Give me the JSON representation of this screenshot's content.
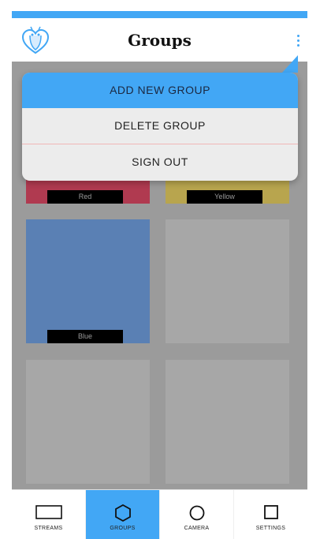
{
  "app": {
    "title": "Groups"
  },
  "icons": {
    "logo": "heart-bug-logo-icon",
    "menu": "overflow-menu-icon"
  },
  "colors": {
    "accent": "#42a7f5",
    "red": "#b03a50",
    "yellow": "#b8a54e",
    "blue": "#5a80b4",
    "empty": "#a7a7a7"
  },
  "groups": [
    {
      "label": "Red",
      "color": "#b03a50"
    },
    {
      "label": "Yellow",
      "color": "#b8a54e"
    },
    {
      "label": "Blue",
      "color": "#5a80b4"
    },
    {
      "label": "",
      "color": "#a7a7a7"
    },
    {
      "label": "",
      "color": "#a7a7a7"
    },
    {
      "label": "",
      "color": "#a7a7a7"
    }
  ],
  "menu": {
    "items": [
      "ADD NEW GROUP",
      "DELETE GROUP",
      "SIGN OUT"
    ]
  },
  "nav": {
    "items": [
      {
        "label": "STREAMS",
        "icon": "rectangle-icon"
      },
      {
        "label": "GROUPS",
        "icon": "hexagon-icon",
        "active": true
      },
      {
        "label": "CAMERA",
        "icon": "circle-icon"
      },
      {
        "label": "SETTINGS",
        "icon": "square-icon"
      }
    ]
  }
}
